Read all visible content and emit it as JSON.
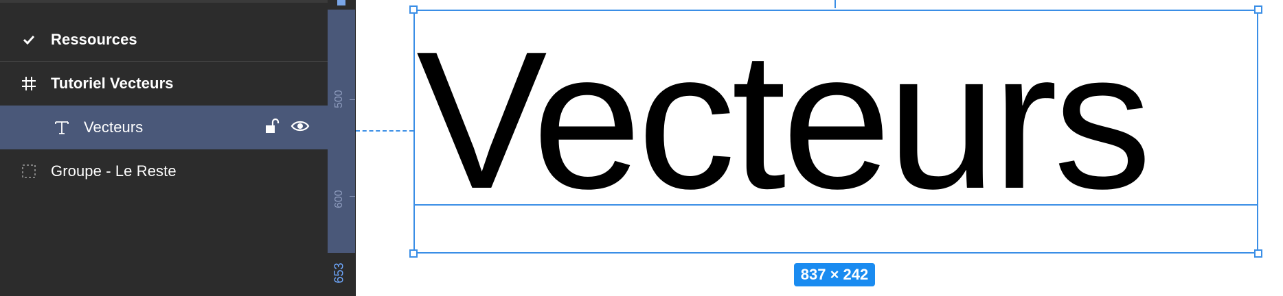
{
  "layers": {
    "items": [
      {
        "label": "Ressources",
        "icon": "check-icon"
      },
      {
        "label": "Tutoriel Vecteurs",
        "icon": "frame-grid-icon"
      },
      {
        "label": "Vecteurs",
        "icon": "text-icon"
      },
      {
        "label": "Groupe - Le Reste",
        "icon": "group-dashed-icon"
      }
    ]
  },
  "ruler": {
    "labels": [
      "500",
      "600",
      "653"
    ]
  },
  "canvas": {
    "text": "Vecteurs",
    "dimensions_badge": "837 × 242"
  },
  "colors": {
    "panel_bg": "#2c2c2c",
    "selected_row": "#4a5879",
    "selection_blue": "#3a8ee6",
    "badge_blue": "#1a8bf0"
  }
}
